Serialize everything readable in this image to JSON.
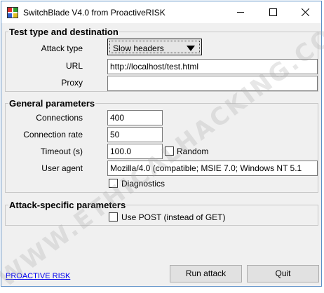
{
  "window": {
    "title": "SwitchBlade V4.0 from ProactiveRISK",
    "controls": [
      "minimize-icon",
      "maximize-icon",
      "close-icon"
    ]
  },
  "test_type": {
    "group_title": "Test type and destination",
    "attack_type_label": "Attack type",
    "attack_type_value": "Slow headers",
    "url_label": "URL",
    "url_value": "http://localhost/test.html",
    "proxy_label": "Proxy",
    "proxy_value": ""
  },
  "general": {
    "group_title": "General parameters",
    "connections_label": "Connections",
    "connections_value": "400",
    "rate_label": "Connection rate",
    "rate_value": "50",
    "timeout_label": "Timeout (s)",
    "timeout_value": "100.0",
    "random_label": "Random",
    "random_checked": false,
    "user_agent_label": "User agent",
    "user_agent_value": "Mozilla/4.0 (compatible; MSIE 7.0; Windows NT 5.1",
    "diagnostics_label": "Diagnostics",
    "diagnostics_checked": false
  },
  "attack_specific": {
    "group_title": "Attack-specific parameters",
    "use_post_label": "Use POST (instead of GET)",
    "use_post_checked": false
  },
  "footer": {
    "link_label": "PROACTIVE RISK",
    "run_label": "Run attack",
    "quit_label": "Quit"
  },
  "watermark": "WWW.ETHICALHACKING.COM"
}
